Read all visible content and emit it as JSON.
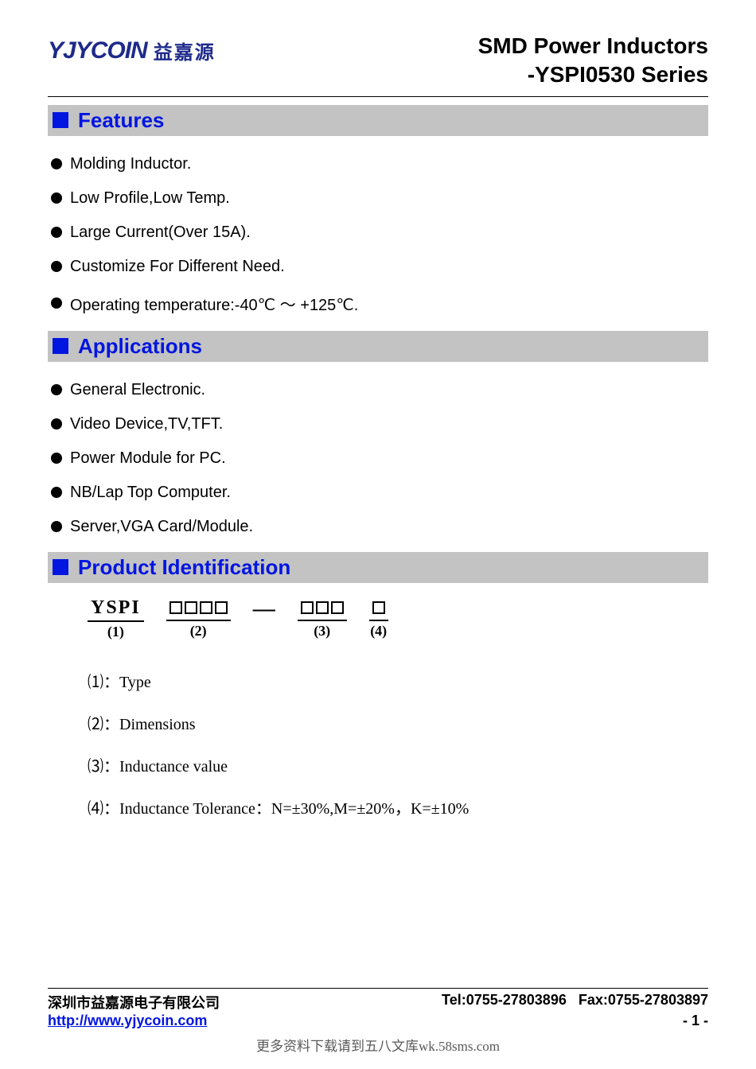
{
  "logo": {
    "english": "YJYCOIN",
    "chinese": "益嘉源"
  },
  "title": {
    "line1": "SMD Power Inductors",
    "line2": "-YSPI0530 Series"
  },
  "sections": {
    "features": {
      "heading": "Features",
      "items": [
        "Molding Inductor.",
        "Low Profile,Low Temp.",
        "Large Current(Over 15A).",
        "Customize For Different Need.",
        "Operating temperature:-40℃ ～ +125℃."
      ]
    },
    "applications": {
      "heading": "Applications",
      "items": [
        "General Electronic.",
        "Video Device,TV,TFT.",
        "Power Module for PC.",
        "NB/Lap Top Computer.",
        "Server,VGA Card/Module."
      ]
    },
    "product_id": {
      "heading": "Product Identification",
      "groups": [
        {
          "top": "YSPI",
          "bottom": "(1)"
        },
        {
          "squares": 4,
          "bottom": "(2)"
        },
        {
          "squares": 3,
          "bottom": "(3)"
        },
        {
          "squares": 1,
          "bottom": "(4)"
        }
      ],
      "defs": [
        {
          "num": "⑴",
          "text": "：Type"
        },
        {
          "num": "⑵",
          "text": "：Dimensions"
        },
        {
          "num": "⑶",
          "text": "：Inductance value"
        },
        {
          "num": "⑷",
          "text": "：Inductance Tolerance：N=±30%,M=±20%，K=±10%"
        }
      ]
    }
  },
  "footer": {
    "company": "深圳市益嘉源电子有限公司",
    "tel": "Tel:0755-27803896",
    "fax": "Fax:0755-27803897",
    "url": "http://www.yjycoin.com",
    "page": "- 1 -"
  },
  "watermark": "更多资料下载请到五八文库wk.58sms.com"
}
